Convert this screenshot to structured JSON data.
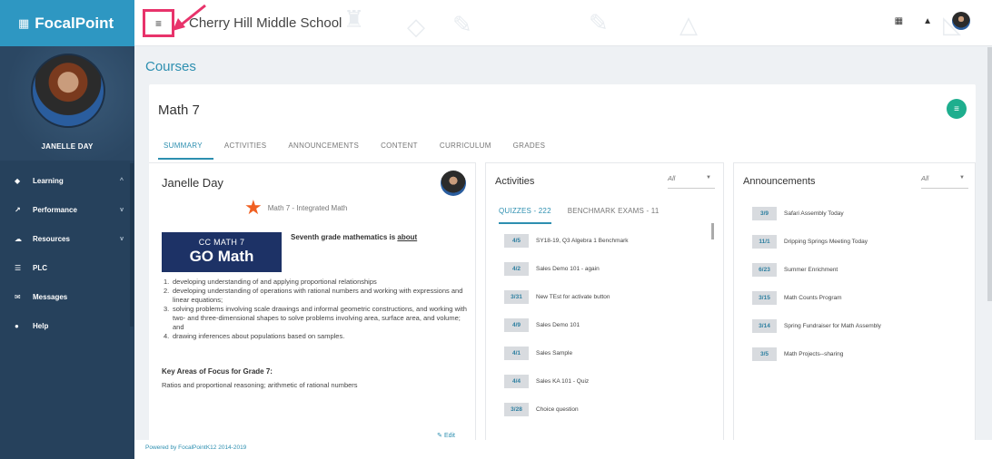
{
  "brand": {
    "name": "FocalPoint",
    "icon": "grid-icon"
  },
  "user": {
    "name": "JANELLE DAY"
  },
  "nav": [
    {
      "label": "Learning",
      "icon": "graduation-cap-icon",
      "chevron": "^"
    },
    {
      "label": "Performance",
      "icon": "trend-icon",
      "chevron": "v"
    },
    {
      "label": "Resources",
      "icon": "cloud-icon",
      "chevron": "v"
    },
    {
      "label": "PLC",
      "icon": "people-icon",
      "chevron": ""
    },
    {
      "label": "Messages",
      "icon": "mail-icon",
      "chevron": ""
    },
    {
      "label": "Help",
      "icon": "help-icon",
      "chevron": ""
    }
  ],
  "topbar": {
    "school": "Cherry Hill Middle School",
    "menu_icon": "≡",
    "apps_icon": "▦",
    "bell_icon": "▲"
  },
  "page": {
    "title": "Courses"
  },
  "course": {
    "title": "Math 7",
    "fab_icon": "≡",
    "tabs": [
      "SUMMARY",
      "ACTIVITIES",
      "ANNOUNCEMENTS",
      "CONTENT",
      "CURRICULUM",
      "GRADES"
    ]
  },
  "summary": {
    "teacher": "Janelle Day",
    "subtitle": "Math 7 - Integrated Math",
    "banner_line1": "CC MATH 7",
    "banner_line2": "GO Math",
    "heading_prefix": "Seventh grade mathematics is ",
    "heading_link": "about",
    "items": [
      {
        "num": "1.",
        "text": "developing understanding of and applying proportional relationships"
      },
      {
        "num": "2.",
        "text": "developing understanding of operations with rational numbers and working with expressions and linear equations;"
      },
      {
        "num": "3.",
        "text": "solving problems involving scale drawings and informal geometric constructions, and working with two- and three-dimensional shapes to solve problems involving area, surface area, and volume; and"
      },
      {
        "num": "4.",
        "text": "drawing inferences about populations based on samples."
      }
    ],
    "focus_heading": "Key Areas of Focus for Grade 7:",
    "focus_text": "Ratios and proportional reasoning; arithmetic of rational numbers",
    "edit_label": "Edit"
  },
  "activities": {
    "title": "Activities",
    "filter": "All",
    "subtabs": [
      "QUIZZES - 222",
      "BENCHMARK EXAMS - 11"
    ],
    "items": [
      {
        "date": "4/5",
        "label": "SY18-19, Q3 Algebra 1 Benchmark"
      },
      {
        "date": "4/2",
        "label": "Sales Demo 101 - again"
      },
      {
        "date": "3/31",
        "label": "New TEst for activate button"
      },
      {
        "date": "4/9",
        "label": "Sales Demo 101"
      },
      {
        "date": "4/1",
        "label": "Sales Sample"
      },
      {
        "date": "4/4",
        "label": "Sales KA 101 - Quiz"
      },
      {
        "date": "3/28",
        "label": "Choice question"
      }
    ]
  },
  "announcements": {
    "title": "Announcements",
    "filter": "All",
    "items": [
      {
        "date": "3/9",
        "label": "Safari Assembly Today"
      },
      {
        "date": "11/1",
        "label": "Dripping Springs Meeting Today"
      },
      {
        "date": "6/23",
        "label": "Summer Enrichment"
      },
      {
        "date": "3/15",
        "label": "Math Counts Program"
      },
      {
        "date": "3/14",
        "label": "Spring Fundraiser for Math Assembly"
      },
      {
        "date": "3/5",
        "label": "Math Projects--sharing"
      }
    ]
  },
  "footer": {
    "text": "Powered by FocalPointK12 2014-2019"
  },
  "colors": {
    "accent": "#2d8fb0",
    "sidebar": "#26415c",
    "brand": "#2e97c2",
    "highlight": "#e8336b",
    "fab": "#1eae8e"
  }
}
